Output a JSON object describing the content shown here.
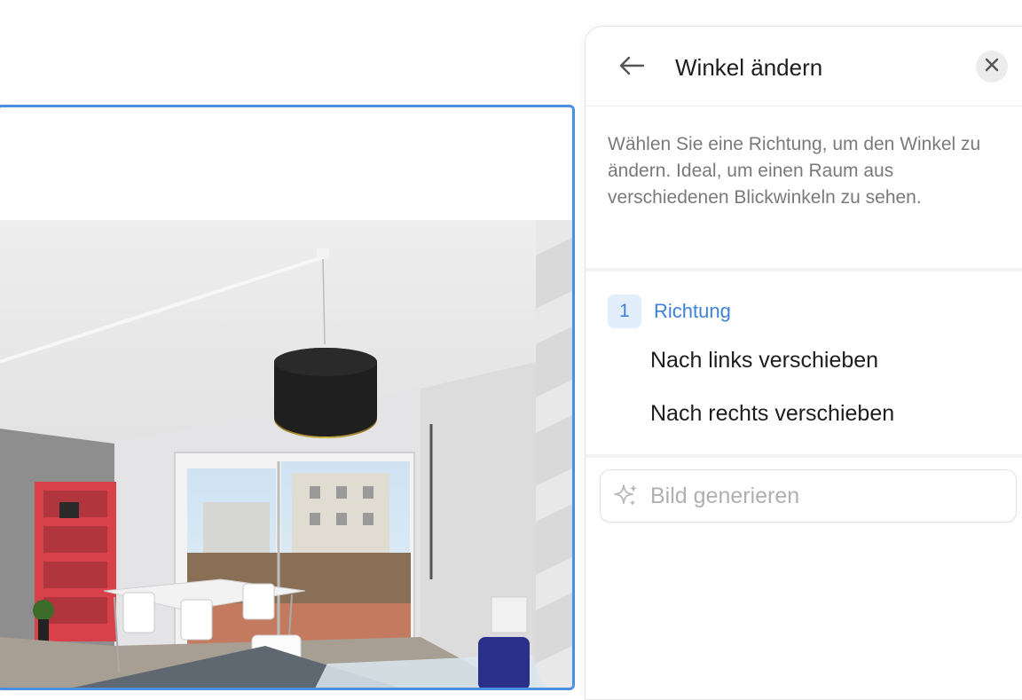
{
  "canvas": {
    "photo_description_icon": "room-photo",
    "frame_color": "#4a90e2"
  },
  "panel": {
    "title": "Winkel ändern",
    "back_icon": "arrow-left-icon",
    "close_icon": "close-icon",
    "description": "Wählen Sie eine Richtung, um den Winkel zu ändern. Ideal, um einen Raum aus verschiedenen Blickwinkeln zu sehen.",
    "step": {
      "number": "1",
      "label": "Richtung"
    },
    "options": [
      {
        "label": "Nach links verschieben"
      },
      {
        "label": "Nach rechts verschieben"
      }
    ],
    "generate": {
      "label": "Bild generieren",
      "icon": "sparkle-icon"
    },
    "accent_color": "#3d82d8"
  }
}
